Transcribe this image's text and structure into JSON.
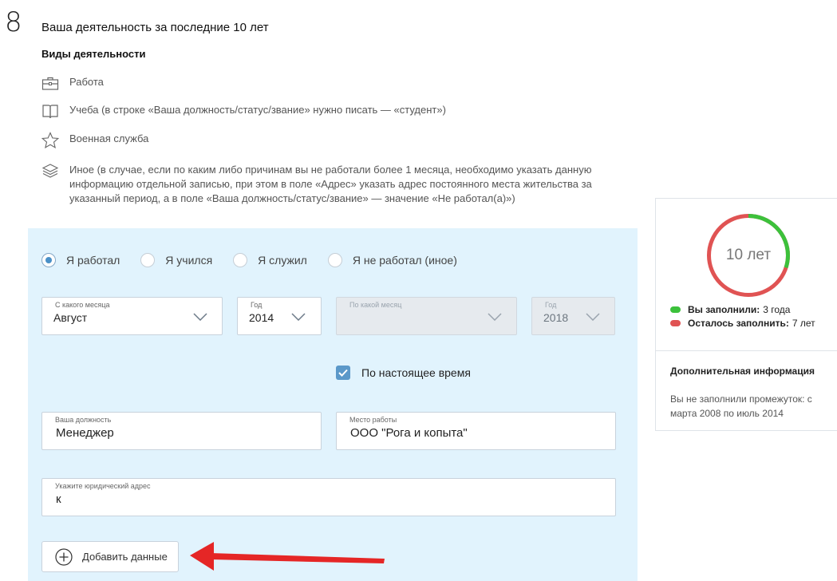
{
  "step_number": "8",
  "section_title": "Ваша деятельность за последние 10 лет",
  "activity_types": {
    "title": "Виды деятельности",
    "items": [
      {
        "icon": "briefcase-icon",
        "label": "Работа"
      },
      {
        "icon": "book-icon",
        "label": "Учеба (в строке «Ваша должность/статус/звание» нужно писать — «студент»)"
      },
      {
        "icon": "star-icon",
        "label": "Военная служба"
      },
      {
        "icon": "layers-icon",
        "label": "Иное (в случае, если по каким либо причинам вы не работали более 1 месяца, необходимо указать данную информацию отдельной записью, при этом в поле «Адрес» указать адрес постоянного места жительства за указанный период, а в поле «Ваша должность/статус/звание» — значение «Не работал(а)»)"
      }
    ]
  },
  "form": {
    "radios": [
      {
        "label": "Я работал",
        "selected": true
      },
      {
        "label": "Я учился",
        "selected": false
      },
      {
        "label": "Я служил",
        "selected": false
      },
      {
        "label": "Я не работал (иное)",
        "selected": false
      }
    ],
    "from_month": {
      "caption": "С какого месяца",
      "value": "Август"
    },
    "from_year": {
      "caption": "Год",
      "value": "2014"
    },
    "to_month": {
      "caption": "По какой месяц",
      "value": "",
      "disabled": true
    },
    "to_year": {
      "caption": "Год",
      "value": "2018",
      "disabled": true
    },
    "present_checkbox": {
      "label": "По настоящее время",
      "checked": true
    },
    "position": {
      "caption": "Ваша должность",
      "value": "Менеджер"
    },
    "workplace": {
      "caption": "Место работы",
      "value": "ООО \"Рога и копыта\""
    },
    "legal_address": {
      "caption": "Укажите юридический адрес",
      "value": "к"
    },
    "add_button": "Добавить данные"
  },
  "progress": {
    "center_label": "10 лет",
    "filled_fraction": 0.3,
    "filled_label": "Вы заполнили:",
    "filled_value": "3 года",
    "remaining_label": "Осталось заполнить:",
    "remaining_value": "7 лет",
    "color_filled": "#3cc13b",
    "color_remaining": "#e05353"
  },
  "extra_info": {
    "title": "Дополнительная информация",
    "text": "Вы не заполнили промежуток: с марта 2008 по июль 2014"
  }
}
